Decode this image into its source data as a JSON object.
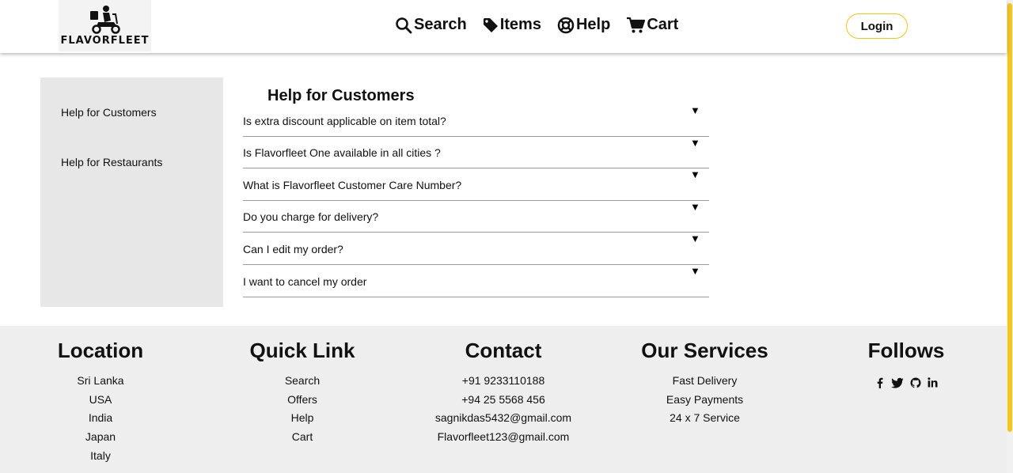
{
  "brand": {
    "name": "FLAVORFLEET"
  },
  "nav": {
    "items": [
      {
        "label": "Search",
        "icon": "search-icon"
      },
      {
        "label": "Items",
        "icon": "tag-icon"
      },
      {
        "label": "Help",
        "icon": "lifebuoy-icon"
      },
      {
        "label": "Cart",
        "icon": "cart-icon"
      }
    ],
    "login_label": "Login"
  },
  "sidebar": {
    "items": [
      {
        "label": "Help for Customers"
      },
      {
        "label": "Help for Restaurants"
      }
    ]
  },
  "faq": {
    "title": "Help for Customers",
    "arrow": "▼",
    "questions": [
      "Is extra discount applicable on item total?",
      "Is Flavorfleet One available in all cities ?",
      "What is Flavorfleet Customer Care Number?",
      "Do you charge for delivery?",
      "Can I edit my order?",
      "I want to cancel my order"
    ]
  },
  "footer": {
    "location": {
      "title": "Location",
      "items": [
        "Sri Lanka",
        "USA",
        "India",
        "Japan",
        "Italy"
      ]
    },
    "quick_link": {
      "title": "Quick Link",
      "items": [
        "Search",
        "Offers",
        "Help",
        "Cart"
      ]
    },
    "contact": {
      "title": "Contact",
      "items": [
        "+91 9233110188",
        "+94 25 5568 456",
        "sagnikdas5432@gmail.com",
        "Flavorfleet123@gmail.com"
      ]
    },
    "services": {
      "title": "Our Services",
      "items": [
        "Fast Delivery",
        "Easy Payments",
        "24 x 7 Service"
      ]
    },
    "follows": {
      "title": "Follows",
      "icons": [
        "facebook-icon",
        "twitter-icon",
        "github-icon",
        "linkedin-icon"
      ]
    }
  },
  "colors": {
    "accent": "#f5c518",
    "sidebar_bg": "#e7e7e7",
    "footer_bg": "#eeeeee"
  }
}
